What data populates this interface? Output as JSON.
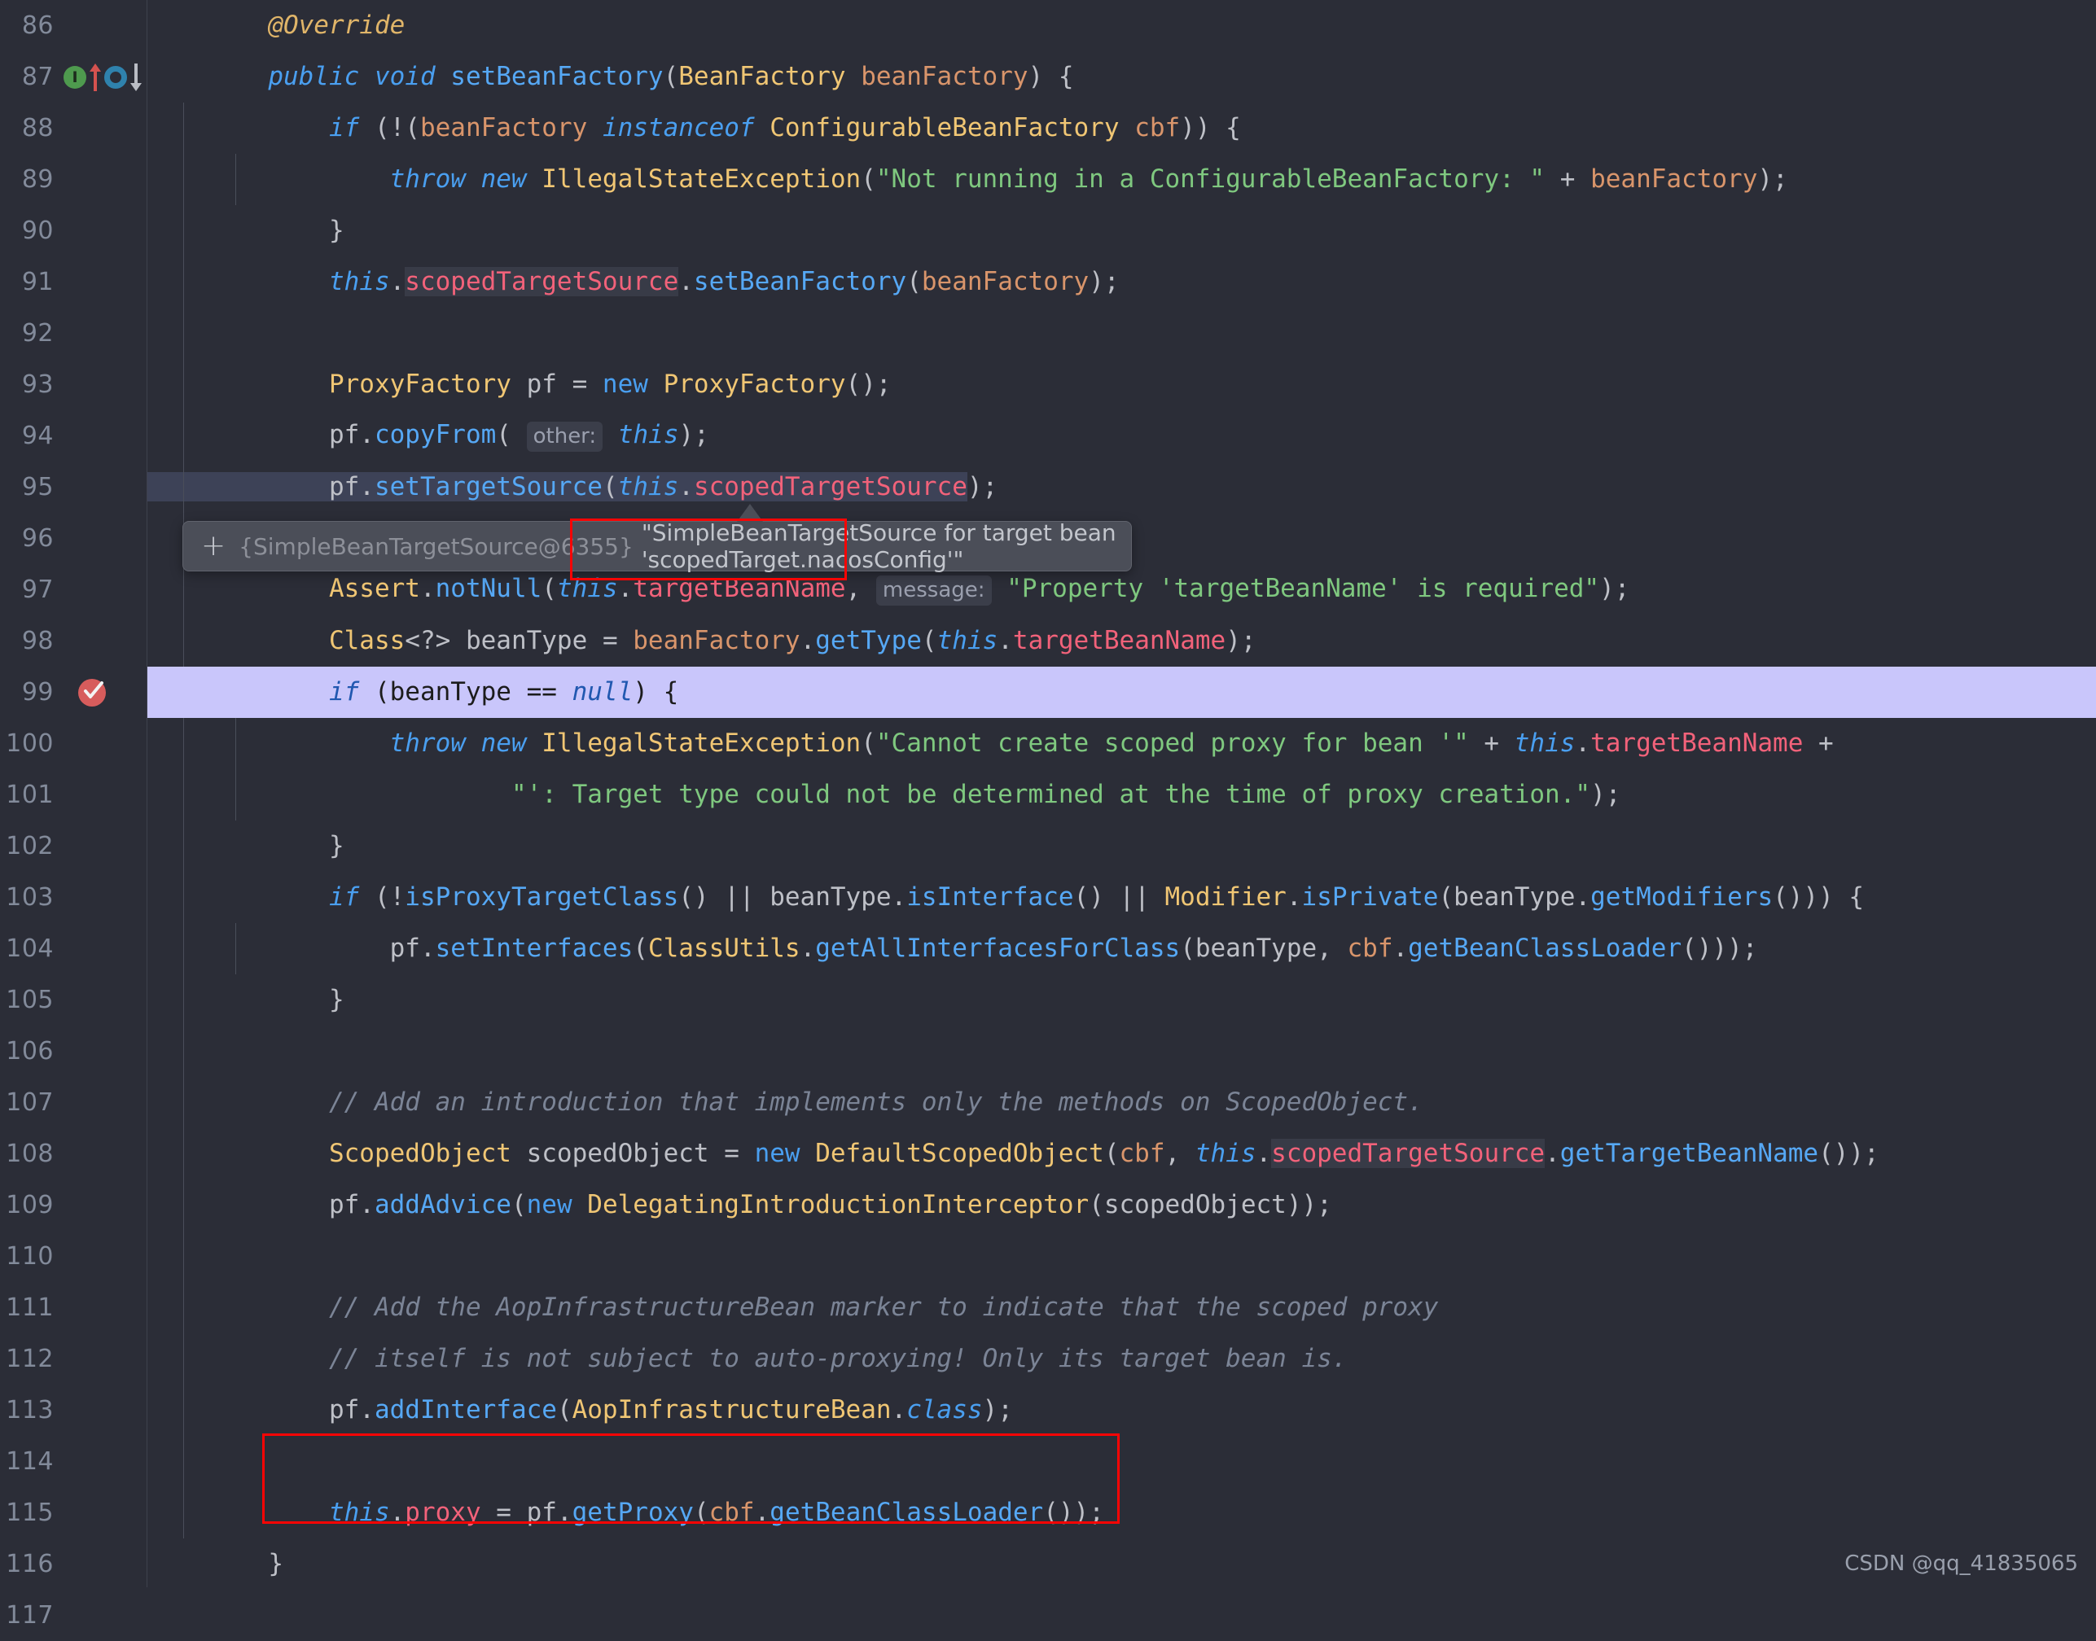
{
  "app": {
    "type": "ide-code-editor",
    "theme": "dark",
    "language": "java",
    "colors": {
      "background": "#2b2d37",
      "gutter_text": "#828a9a",
      "keyword": "#4a9ff0",
      "class": "#f0c674",
      "method": "#56a8f5",
      "field": "#f2627a",
      "parameter": "#d9956b",
      "string": "#7fc87f",
      "comment": "#7b8496",
      "annotation_box": "#fa0505",
      "execution_line": "#c9c6fb",
      "tooltip_bg": "#4b4e58"
    }
  },
  "watermark": "CSDN @qq_41835065",
  "tooltip": {
    "expand_icon": "plus-icon",
    "reference": "{SimpleBeanTargetSource@6355}",
    "value": "\"SimpleBeanTargetSource for target bean 'scopedTarget.nacosConfig'\""
  },
  "gutter_markers": [
    {
      "line": 87,
      "icons": [
        "implementing-method-icon",
        "up-arrow-icon",
        "overriding-method-icon",
        "down-arrow-icon"
      ],
      "labels": [
        "I",
        "O"
      ]
    },
    {
      "line": 99,
      "icons": [
        "breakpoint-verified-icon"
      ]
    }
  ],
  "execution_line": 99,
  "lines": [
    {
      "n": 86,
      "indent": 1,
      "guides": 0,
      "text": "@Override"
    },
    {
      "n": 87,
      "indent": 1,
      "guides": 0,
      "text": "public void setBeanFactory(BeanFactory beanFactory) {"
    },
    {
      "n": 88,
      "indent": 2,
      "guides": 1,
      "text": "if (!(beanFactory instanceof ConfigurableBeanFactory cbf)) {"
    },
    {
      "n": 89,
      "indent": 3,
      "guides": 2,
      "text": "throw new IllegalStateException(\"Not running in a ConfigurableBeanFactory: \" + beanFactory);"
    },
    {
      "n": 90,
      "indent": 2,
      "guides": 1,
      "text": "}"
    },
    {
      "n": 91,
      "indent": 2,
      "guides": 1,
      "text": "this.scopedTargetSource.setBeanFactory(beanFactory);"
    },
    {
      "n": 92,
      "indent": 2,
      "guides": 1,
      "text": ""
    },
    {
      "n": 93,
      "indent": 2,
      "guides": 1,
      "text": "ProxyFactory pf = new ProxyFactory();"
    },
    {
      "n": 94,
      "indent": 2,
      "guides": 1,
      "text": "pf.copyFrom( other: this);"
    },
    {
      "n": 95,
      "indent": 2,
      "guides": 1,
      "text": "pf.setTargetSource(this.scopedTargetSource);"
    },
    {
      "n": 96,
      "indent": 2,
      "guides": 1,
      "text": ""
    },
    {
      "n": 97,
      "indent": 2,
      "guides": 1,
      "text": "Assert.notNull(this.targetBeanName, message: \"Property 'targetBeanName' is required\");"
    },
    {
      "n": 98,
      "indent": 2,
      "guides": 1,
      "text": "Class<?> beanType = beanFactory.getType(this.targetBeanName);"
    },
    {
      "n": 99,
      "indent": 2,
      "guides": 1,
      "text": "if (beanType == null) {"
    },
    {
      "n": 100,
      "indent": 3,
      "guides": 2,
      "text": "throw new IllegalStateException(\"Cannot create scoped proxy for bean '\" + this.targetBeanName +"
    },
    {
      "n": 101,
      "indent": 4,
      "guides": 2,
      "text": "\"': Target type could not be determined at the time of proxy creation.\");"
    },
    {
      "n": 102,
      "indent": 2,
      "guides": 1,
      "text": "}"
    },
    {
      "n": 103,
      "indent": 2,
      "guides": 1,
      "text": "if (!isProxyTargetClass() || beanType.isInterface() || Modifier.isPrivate(beanType.getModifiers())) {"
    },
    {
      "n": 104,
      "indent": 3,
      "guides": 2,
      "text": "pf.setInterfaces(ClassUtils.getAllInterfacesForClass(beanType, cbf.getBeanClassLoader()));"
    },
    {
      "n": 105,
      "indent": 2,
      "guides": 1,
      "text": "}"
    },
    {
      "n": 106,
      "indent": 2,
      "guides": 1,
      "text": ""
    },
    {
      "n": 107,
      "indent": 2,
      "guides": 1,
      "text": "// Add an introduction that implements only the methods on ScopedObject."
    },
    {
      "n": 108,
      "indent": 2,
      "guides": 1,
      "text": "ScopedObject scopedObject = new DefaultScopedObject(cbf, this.scopedTargetSource.getTargetBeanName());"
    },
    {
      "n": 109,
      "indent": 2,
      "guides": 1,
      "text": "pf.addAdvice(new DelegatingIntroductionInterceptor(scopedObject));"
    },
    {
      "n": 110,
      "indent": 2,
      "guides": 1,
      "text": ""
    },
    {
      "n": 111,
      "indent": 2,
      "guides": 1,
      "text": "// Add the AopInfrastructureBean marker to indicate that the scoped proxy"
    },
    {
      "n": 112,
      "indent": 2,
      "guides": 1,
      "text": "// itself is not subject to auto-proxying! Only its target bean is."
    },
    {
      "n": 113,
      "indent": 2,
      "guides": 1,
      "text": "pf.addInterface(AopInfrastructureBean.class);"
    },
    {
      "n": 114,
      "indent": 2,
      "guides": 1,
      "text": ""
    },
    {
      "n": 115,
      "indent": 2,
      "guides": 1,
      "text": "this.proxy = pf.getProxy(cbf.getBeanClassLoader());"
    },
    {
      "n": 116,
      "indent": 1,
      "guides": 0,
      "text": "}"
    },
    {
      "n": 117,
      "indent": 1,
      "guides": 0,
      "text": ""
    }
  ],
  "annotations": [
    {
      "name": "tooltip-value-highlight",
      "shape": "rectangle",
      "color": "#fa0505"
    },
    {
      "name": "proxy-assignment-highlight",
      "shape": "rectangle",
      "color": "#fa0505"
    }
  ]
}
